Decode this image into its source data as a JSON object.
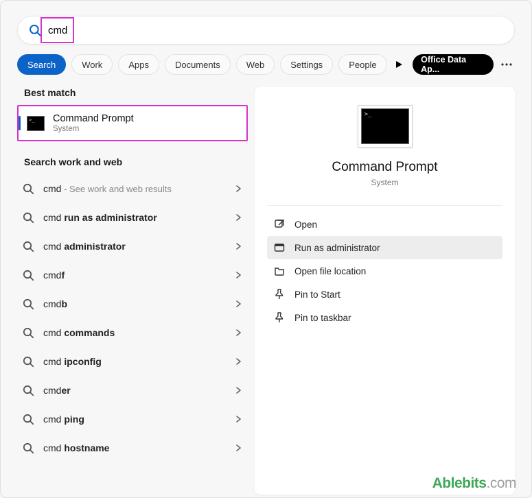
{
  "search": {
    "value": "cmd"
  },
  "tabs": [
    "Search",
    "Work",
    "Apps",
    "Documents",
    "Web",
    "Settings",
    "People"
  ],
  "active_tab_index": 0,
  "office_pill": "Office Data Ap...",
  "left": {
    "best_match_label": "Best match",
    "best_match": {
      "title": "Command Prompt",
      "subtitle": "System"
    },
    "suggestions_label": "Search work and web",
    "suggestions": [
      {
        "prefix": "cmd",
        "bold": "",
        "hint": " - See work and web results"
      },
      {
        "prefix": "cmd ",
        "bold": "run as administrator",
        "hint": ""
      },
      {
        "prefix": "cmd ",
        "bold": "administrator",
        "hint": ""
      },
      {
        "prefix": "cmd",
        "bold": "f",
        "hint": ""
      },
      {
        "prefix": "cmd",
        "bold": "b",
        "hint": ""
      },
      {
        "prefix": "cmd ",
        "bold": "commands",
        "hint": ""
      },
      {
        "prefix": "cmd ",
        "bold": "ipconfig",
        "hint": ""
      },
      {
        "prefix": "cmd",
        "bold": "er",
        "hint": ""
      },
      {
        "prefix": "cmd ",
        "bold": "ping",
        "hint": ""
      },
      {
        "prefix": "cmd ",
        "bold": "hostname",
        "hint": ""
      }
    ]
  },
  "right": {
    "title": "Command Prompt",
    "subtitle": "System",
    "actions": [
      {
        "icon": "open",
        "label": "Open",
        "selected": false
      },
      {
        "icon": "admin",
        "label": "Run as administrator",
        "selected": true
      },
      {
        "icon": "folder",
        "label": "Open file location",
        "selected": false
      },
      {
        "icon": "pin",
        "label": "Pin to Start",
        "selected": false
      },
      {
        "icon": "pin",
        "label": "Pin to taskbar",
        "selected": false
      }
    ]
  },
  "watermark": {
    "brand": "Ablebits",
    "tld": ".com"
  }
}
